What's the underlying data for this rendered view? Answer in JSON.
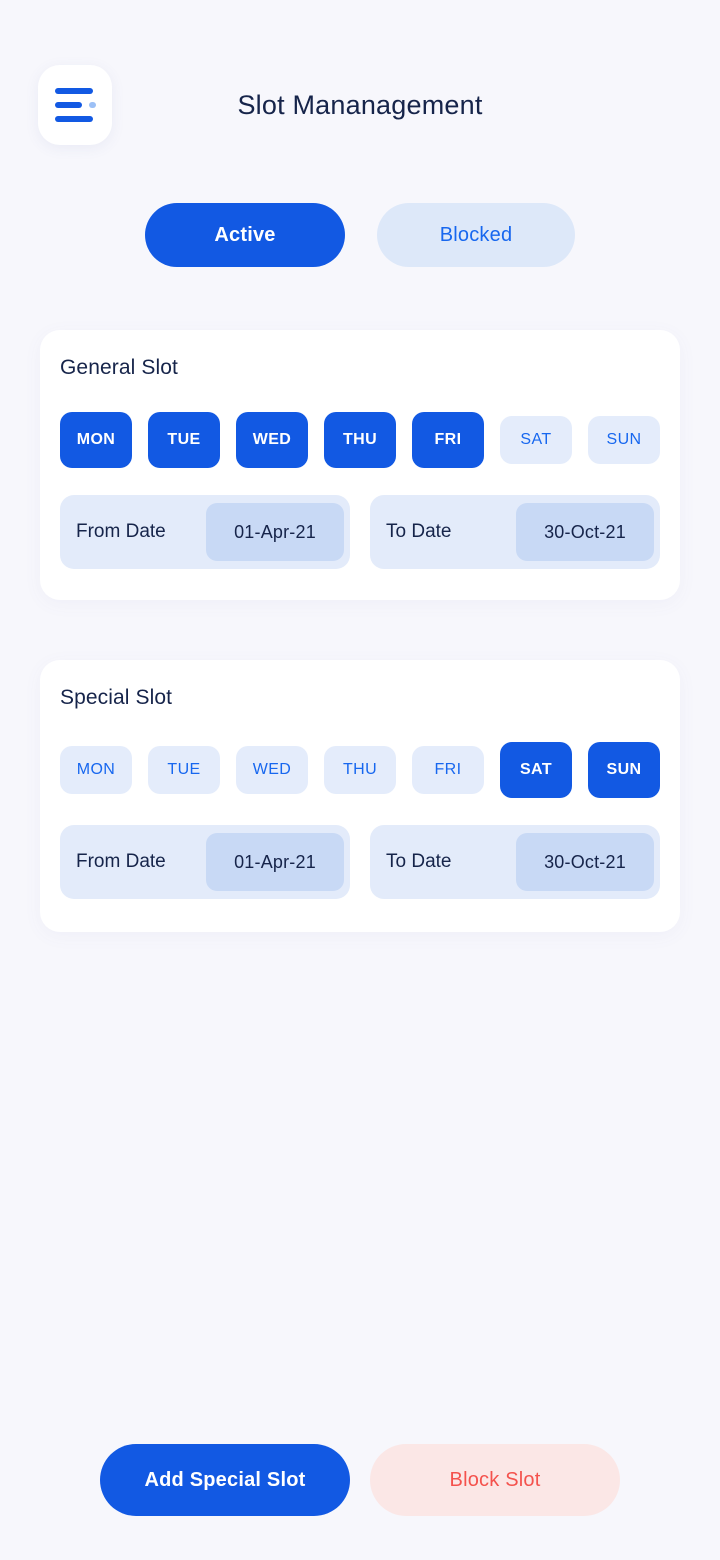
{
  "header": {
    "title": "Slot Mananagement",
    "menu_icon": "hamburger-menu-icon"
  },
  "tabs": [
    {
      "label": "Active",
      "state": "selected"
    },
    {
      "label": "Blocked",
      "state": "unselected"
    }
  ],
  "cards": [
    {
      "title": "General Slot",
      "days": [
        {
          "label": "MON",
          "selected": true
        },
        {
          "label": "TUE",
          "selected": true
        },
        {
          "label": "WED",
          "selected": true
        },
        {
          "label": "THU",
          "selected": true
        },
        {
          "label": "FRI",
          "selected": true
        },
        {
          "label": "SAT",
          "selected": false
        },
        {
          "label": "SUN",
          "selected": false
        }
      ],
      "from": {
        "label": "From Date",
        "value": "01-Apr-21"
      },
      "to": {
        "label": "To Date",
        "value": "30-Oct-21"
      }
    },
    {
      "title": "Special Slot",
      "days": [
        {
          "label": "MON",
          "selected": false
        },
        {
          "label": "TUE",
          "selected": false
        },
        {
          "label": "WED",
          "selected": false
        },
        {
          "label": "THU",
          "selected": false
        },
        {
          "label": "FRI",
          "selected": false
        },
        {
          "label": "SAT",
          "selected": true
        },
        {
          "label": "SUN",
          "selected": true
        }
      ],
      "from": {
        "label": "From Date",
        "value": "01-Apr-21"
      },
      "to": {
        "label": "To Date",
        "value": "30-Oct-21"
      }
    }
  ],
  "actions": [
    {
      "label": "Add Special Slot",
      "kind": "primary"
    },
    {
      "label": "Block Slot",
      "kind": "danger"
    }
  ],
  "colors": {
    "background": "#f7f7fc",
    "card": "#ffffff",
    "accent_blue": "#1259e3",
    "accent_blue_soft": "#e4ecfb",
    "tab_inactive_bg": "#dde8f9",
    "date_field_bg": "#e3ebfa",
    "date_value_bg": "#c8d9f5",
    "text_dark": "#16244a",
    "danger_red": "#f4524d",
    "danger_bg": "#fbe7e6"
  }
}
